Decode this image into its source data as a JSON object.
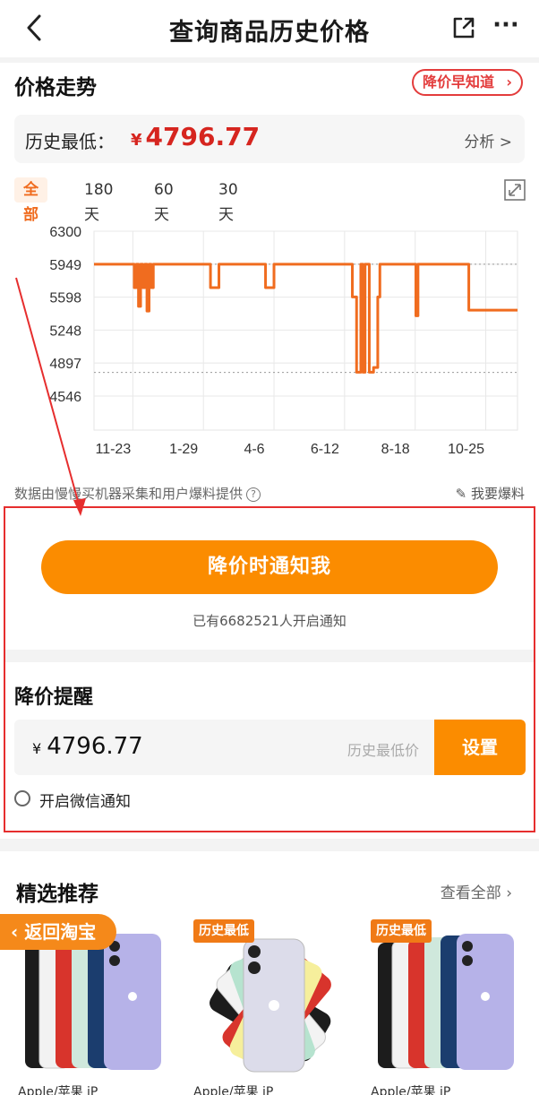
{
  "header": {
    "title": "查询商品历史价格",
    "more": "···"
  },
  "trend": {
    "title": "价格走势",
    "early_notice": "降价早知道",
    "lowest_label": "历史最低：",
    "currency": "¥",
    "lowest_value": "4796.77",
    "analysis": "分析 >",
    "tabs": [
      "全部",
      "180天",
      "60天",
      "30天"
    ],
    "active_tab": "全部"
  },
  "chart_data": {
    "type": "line",
    "x_ticks": [
      "11-23",
      "1-29",
      "4-6",
      "6-12",
      "8-18",
      "10-25"
    ],
    "y_ticks": [
      6300,
      5949,
      5598,
      5248,
      4897,
      4546
    ],
    "ylim": [
      4546,
      6300
    ],
    "reference_lines": [
      5949,
      4797
    ],
    "color": "#f06c1f",
    "series": [
      {
        "x": [
          0,
          0.09,
          0.095,
          0.1,
          0.105,
          0.11,
          0.115,
          0.12,
          0.125,
          0.13,
          0.135,
          0.14,
          0.15,
          0.27,
          0.275,
          0.29,
          0.295,
          0.4,
          0.405,
          0.42,
          0.425,
          0.6,
          0.61,
          0.62,
          0.63,
          0.635,
          0.64,
          0.65,
          0.66,
          0.67,
          0.675,
          0.68,
          0.69,
          0.75,
          0.76,
          0.765,
          0.77,
          0.78,
          0.88,
          0.885,
          1.0
        ],
        "y": [
          5949,
          5949,
          5700,
          5949,
          5500,
          5949,
          5700,
          5949,
          5450,
          5949,
          5700,
          5949,
          5949,
          5949,
          5700,
          5700,
          5949,
          5949,
          5700,
          5700,
          5949,
          5949,
          5600,
          4800,
          5949,
          4800,
          5949,
          4800,
          4850,
          5600,
          5949,
          5949,
          5949,
          5949,
          5400,
          5949,
          5949,
          5949,
          5949,
          5460,
          5460
        ]
      }
    ]
  },
  "note": {
    "source": "数据由慢慢买机器采集和用户爆料提供",
    "qmark": "?",
    "report": "我要爆料"
  },
  "notify": {
    "button": "降价时通知我",
    "subscribers": "已有6682521人开启通知"
  },
  "alert": {
    "title": "降价提醒",
    "currency": "¥",
    "price": "4796.77",
    "hint": "历史最低价",
    "set_button": "设置",
    "wechat": "开启微信通知"
  },
  "recommend": {
    "title": "精选推荐",
    "view_all": "查看全部",
    "back_taobao": "返回淘宝",
    "badge": "历史最低",
    "item_label": "Apple/苹果 iP"
  },
  "colors": {
    "accent": "#fb8c00",
    "price_red": "#d6251f",
    "line": "#f06c1f",
    "highlight_border": "#e62e2e"
  }
}
